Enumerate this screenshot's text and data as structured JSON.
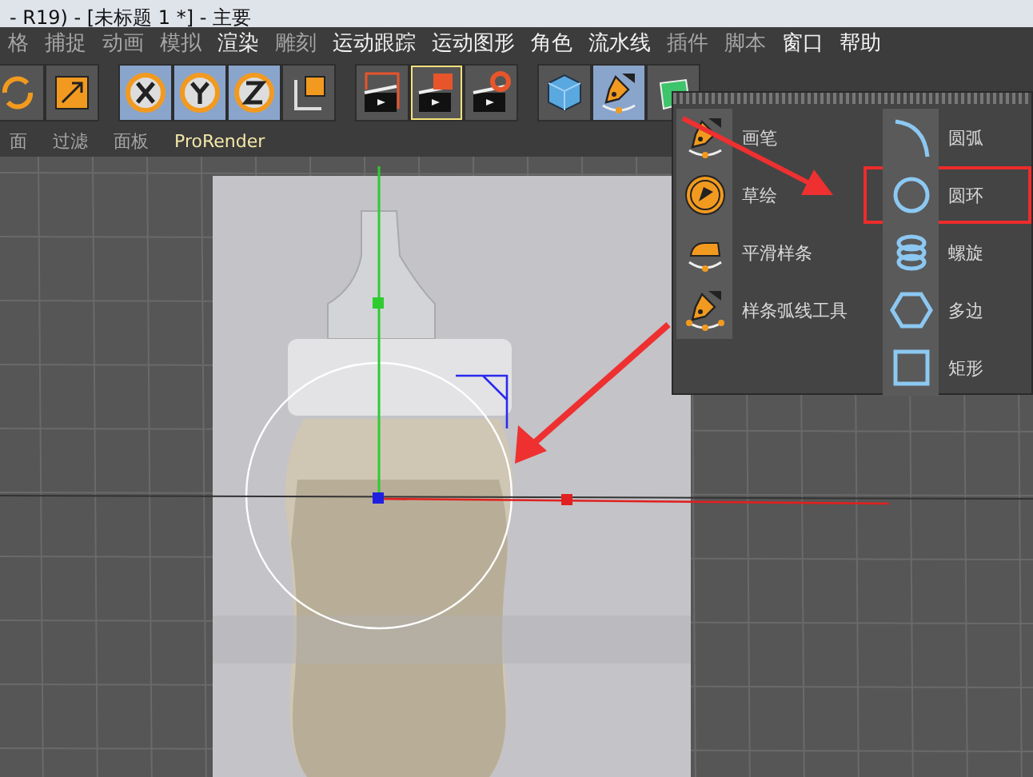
{
  "window": {
    "title": "- R19) - [未标题 1 *] - 主要"
  },
  "menu": [
    {
      "label": "格",
      "highlighted": false
    },
    {
      "label": "捕捉",
      "highlighted": false
    },
    {
      "label": "动画",
      "highlighted": false
    },
    {
      "label": "模拟",
      "highlighted": false
    },
    {
      "label": "渲染",
      "highlighted": true
    },
    {
      "label": "雕刻",
      "highlighted": false
    },
    {
      "label": "运动跟踪",
      "highlighted": true
    },
    {
      "label": "运动图形",
      "highlighted": true
    },
    {
      "label": "角色",
      "highlighted": true
    },
    {
      "label": "流水线",
      "highlighted": true
    },
    {
      "label": "插件",
      "highlighted": false
    },
    {
      "label": "脚本",
      "highlighted": false
    },
    {
      "label": "窗口",
      "highlighted": true
    },
    {
      "label": "帮助",
      "highlighted": true
    }
  ],
  "toolbar": [
    {
      "kind": "rotate",
      "selected": false
    },
    {
      "kind": "scale",
      "selected": false
    },
    {
      "kind": "x",
      "selected": true
    },
    {
      "kind": "y",
      "selected": true
    },
    {
      "kind": "z",
      "selected": true
    },
    {
      "kind": "coords",
      "selected": false
    },
    {
      "kind": "render-view",
      "selected": false
    },
    {
      "kind": "render-picture",
      "selected": true
    },
    {
      "kind": "render-settings",
      "selected": false
    },
    {
      "kind": "cube",
      "selected": false
    },
    {
      "kind": "pen",
      "selected": true
    },
    {
      "kind": "nurbs",
      "selected": false
    }
  ],
  "submenu": [
    {
      "label": "面",
      "highlighted": false
    },
    {
      "label": "过滤",
      "highlighted": false
    },
    {
      "label": "面板",
      "highlighted": false
    },
    {
      "label": "ProRender",
      "highlighted": true
    }
  ],
  "popup": {
    "tools": [
      {
        "kind": "pen",
        "label": "画笔"
      },
      {
        "kind": "sketch",
        "label": "草绘"
      },
      {
        "kind": "smooth",
        "label": "平滑样条"
      },
      {
        "kind": "spline-arc",
        "label": "样条弧线工具"
      }
    ],
    "primitives": [
      {
        "kind": "arc",
        "label": "圆弧",
        "highlighted": false
      },
      {
        "kind": "circle",
        "label": "圆环",
        "highlighted": true
      },
      {
        "kind": "helix",
        "label": "螺旋",
        "highlighted": false
      },
      {
        "kind": "polygon",
        "label": "多边",
        "highlighted": false
      },
      {
        "kind": "rectangle",
        "label": "矩形",
        "highlighted": false
      }
    ]
  }
}
